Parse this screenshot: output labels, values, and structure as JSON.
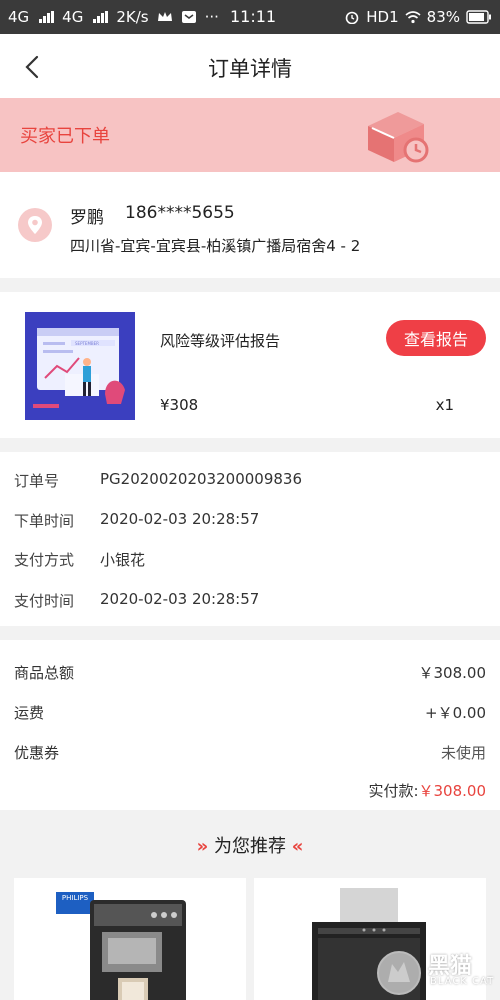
{
  "status_bar": {
    "network1": "4G",
    "network2": "4G",
    "speed": "2K/s",
    "time": "11:11",
    "hd": "HD1",
    "battery": "83%"
  },
  "nav": {
    "title": "订单详情"
  },
  "banner": {
    "status": "买家已下单"
  },
  "address": {
    "name": "罗鹏",
    "phone": "186****5655",
    "line": "四川省-宜宾-宜宾县-柏溪镇广播局宿舍4 - 2"
  },
  "product": {
    "name": "风险等级评估报告",
    "button": "查看报告",
    "price": "¥308",
    "quantity": "x1",
    "thumb_text": "SEPTEMBER"
  },
  "order_info": [
    {
      "label": "订单号",
      "value": "PG2020020203200009836"
    },
    {
      "label": "下单时间",
      "value": "2020-02-03 20:28:57"
    },
    {
      "label": "支付方式",
      "value": "小银花"
    },
    {
      "label": "支付时间",
      "value": "2020-02-03 20:28:57"
    }
  ],
  "totals": [
    {
      "label": "商品总额",
      "value": "￥308.00"
    },
    {
      "label": "运费",
      "value": "+￥0.00"
    },
    {
      "label": "优惠券",
      "value": "未使用"
    }
  ],
  "paid": {
    "label": "实付款:",
    "amount": "￥308.00"
  },
  "recommend": {
    "title": "为您推荐",
    "chevron_left": "»",
    "chevron_right": "«"
  },
  "recommend_cards": [
    {
      "brand": "PHILIPS"
    },
    {
      "brand": ""
    }
  ],
  "watermark": {
    "text": "黑猫",
    "sub": "BLACK CAT"
  },
  "colors": {
    "accent": "#ef3f46",
    "banner_bg": "#f7c3c3",
    "banner_text": "#e8443e"
  }
}
